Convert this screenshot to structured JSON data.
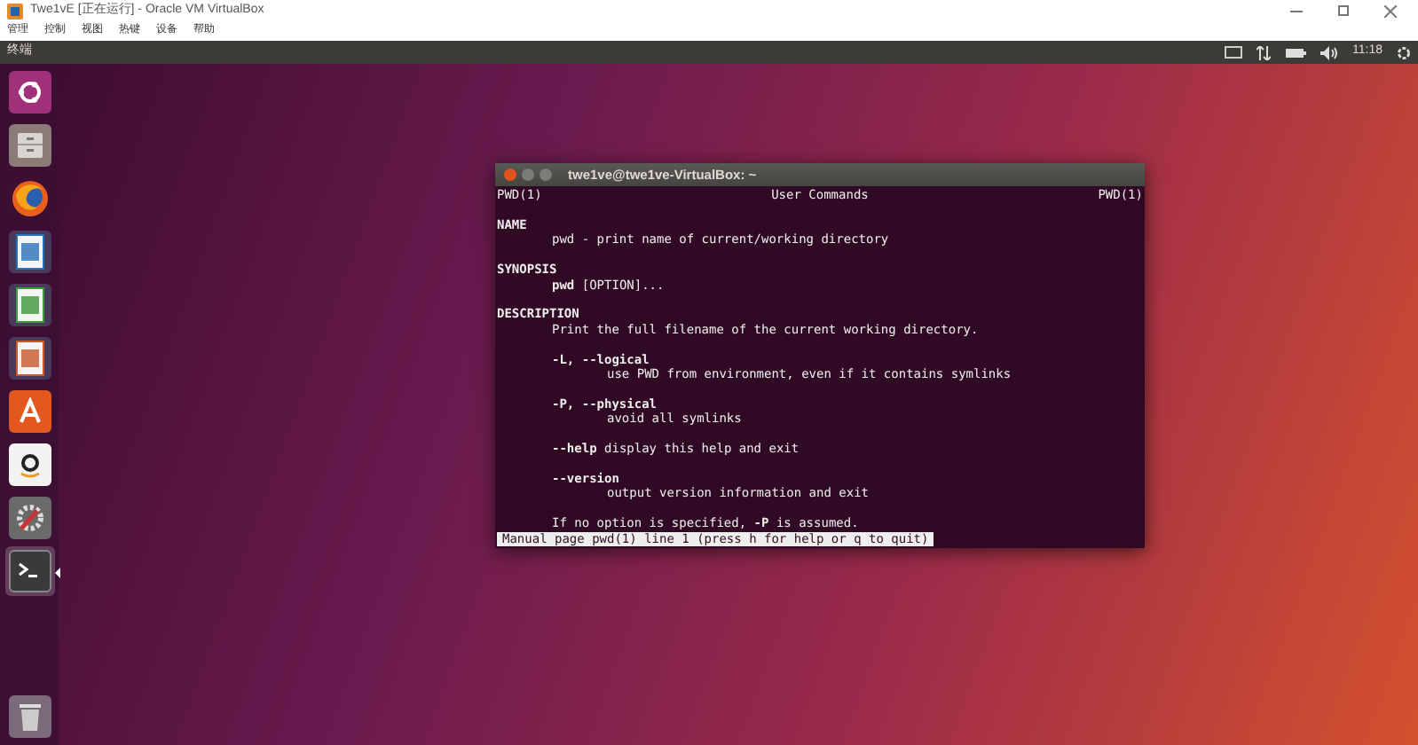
{
  "window": {
    "title": "Twe1vE [正在运行] - Oracle VM VirtualBox"
  },
  "menu": [
    "管理",
    "控制",
    "视图",
    "热键",
    "设备",
    "帮助"
  ],
  "top_panel": {
    "app_name": "终端",
    "clock": "11:18"
  },
  "launcher": [
    {
      "kind": "ubuntu",
      "selected": false
    },
    {
      "kind": "files",
      "selected": false
    },
    {
      "kind": "browser",
      "selected": false
    },
    {
      "kind": "writer",
      "selected": false
    },
    {
      "kind": "calc",
      "selected": false
    },
    {
      "kind": "impress",
      "selected": false
    },
    {
      "kind": "store",
      "selected": false
    },
    {
      "kind": "amazon",
      "selected": false
    },
    {
      "kind": "settings",
      "selected": false
    },
    {
      "kind": "terminal",
      "selected": true
    },
    {
      "kind": "trash",
      "selected": false
    }
  ],
  "terminal": {
    "title": "twe1ve@twe1ve-VirtualBox: ~",
    "header": [
      "PWD(1)",
      "User Commands",
      "PWD(1)"
    ],
    "lines": [
      {
        "kind": "blank"
      },
      {
        "kind": "heading",
        "text": "NAME"
      },
      {
        "kind": "indent1",
        "text": "pwd - print name of current/working directory"
      },
      {
        "kind": "blank"
      },
      {
        "kind": "heading",
        "text": "SYNOPSIS"
      },
      {
        "kind": "indent1",
        "text": "**pwd** [OPTION]..."
      },
      {
        "kind": "blank"
      },
      {
        "kind": "heading",
        "text": "DESCRIPTION"
      },
      {
        "kind": "indent1",
        "text": "Print the full filename of the current working directory."
      },
      {
        "kind": "blank"
      },
      {
        "kind": "option",
        "text": "-L, --logical"
      },
      {
        "kind": "indent2",
        "text": "use PWD from environment, even if it contains symlinks"
      },
      {
        "kind": "blank"
      },
      {
        "kind": "option",
        "text": "-P, --physical"
      },
      {
        "kind": "indent2",
        "text": "avoid all symlinks"
      },
      {
        "kind": "blank"
      },
      {
        "kind": "indent1",
        "text": "**--help** display this help and exit"
      },
      {
        "kind": "blank"
      },
      {
        "kind": "option",
        "text": "--version"
      },
      {
        "kind": "indent2",
        "text": "output version information and exit"
      },
      {
        "kind": "blank"
      },
      {
        "kind": "indent1",
        "text": "If no option is specified, **-P** is assumed."
      }
    ],
    "status_line": "Manual page pwd(1) line 1 (press h for help or q to quit)"
  }
}
